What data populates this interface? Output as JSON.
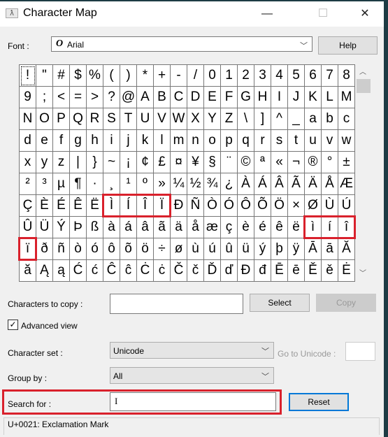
{
  "window": {
    "title": "Character Map",
    "minimize": "—",
    "maximize": "☐",
    "close": "✕"
  },
  "font": {
    "label": "Font :",
    "value": "Arial",
    "font_icon": "O",
    "help": "Help"
  },
  "grid": {
    "rows": [
      [
        "!",
        "\"",
        "#",
        "$",
        "%",
        "(",
        ")",
        "*",
        "+",
        "-",
        "/",
        "0",
        "1",
        "2",
        "3",
        "4",
        "5",
        "6",
        "7",
        "8"
      ],
      [
        "9",
        ";",
        "<",
        "=",
        ">",
        "?",
        "@",
        "A",
        "B",
        "C",
        "D",
        "E",
        "F",
        "G",
        "H",
        "I",
        "J",
        "K",
        "L",
        "M"
      ],
      [
        "N",
        "O",
        "P",
        "Q",
        "R",
        "S",
        "T",
        "U",
        "V",
        "W",
        "X",
        "Y",
        "Z",
        "\\",
        "]",
        "^",
        "_",
        "a",
        "b",
        "c"
      ],
      [
        "d",
        "e",
        "f",
        "g",
        "h",
        "i",
        "j",
        "k",
        "l",
        "m",
        "n",
        "o",
        "p",
        "q",
        "r",
        "s",
        "t",
        "u",
        "v",
        "w"
      ],
      [
        "x",
        "y",
        "z",
        "|",
        "}",
        "~",
        "¡",
        "¢",
        "£",
        "¤",
        "¥",
        "§",
        "¨",
        "©",
        "ª",
        "«",
        "¬",
        "®",
        "°",
        "±"
      ],
      [
        "²",
        "³",
        "µ",
        "¶",
        "·",
        "¸",
        "¹",
        "º",
        "»",
        "¼",
        "½",
        "¾",
        "¿",
        "À",
        "Á",
        "Â",
        "Ã",
        "Ä",
        "Å",
        "Æ"
      ],
      [
        "Ç",
        "È",
        "É",
        "Ê",
        "Ë",
        "Ì",
        "Í",
        "Î",
        "Ï",
        "Ð",
        "Ñ",
        "Ò",
        "Ó",
        "Ô",
        "Õ",
        "Ö",
        "×",
        "Ø",
        "Ù",
        "Ú"
      ],
      [
        "Û",
        "Ü",
        "Ý",
        "Þ",
        "ß",
        "à",
        "á",
        "â",
        "ã",
        "ä",
        "å",
        "æ",
        "ç",
        "è",
        "é",
        "ê",
        "ë",
        "ì",
        "í",
        "î"
      ],
      [
        "ï",
        "ð",
        "ñ",
        "ò",
        "ó",
        "ô",
        "õ",
        "ö",
        "÷",
        "ø",
        "ù",
        "ú",
        "û",
        "ü",
        "ý",
        "þ",
        "ÿ",
        "Ā",
        "ā",
        "Ă"
      ],
      [
        "ă",
        "Ą",
        "ą",
        "Ć",
        "ć",
        "Ĉ",
        "ĉ",
        "Ċ",
        "ċ",
        "Č",
        "č",
        "Ď",
        "ď",
        "Đ",
        "đ",
        "Ē",
        "ē",
        "Ě",
        "ě",
        "Ė"
      ]
    ],
    "highlights": [
      {
        "row": 6,
        "col_start": 5,
        "col_end": 8
      },
      {
        "row": 7,
        "col_start": 17,
        "col_end": 19
      },
      {
        "row": 8,
        "col_start": 0,
        "col_end": 0
      }
    ],
    "highlight_color": "#d9212c"
  },
  "copy": {
    "label": "Characters to copy :",
    "value": "",
    "select": "Select",
    "copy": "Copy"
  },
  "advanced": {
    "label": "Advanced view",
    "checked": true
  },
  "charset": {
    "label": "Character set :",
    "value": "Unicode",
    "goto_label": "Go to Unicode :",
    "goto_value": ""
  },
  "group": {
    "label": "Group by :",
    "value": "All"
  },
  "search": {
    "label": "Search for :",
    "value": "I",
    "reset": "Reset"
  },
  "status": "U+0021: Exclamation Mark"
}
